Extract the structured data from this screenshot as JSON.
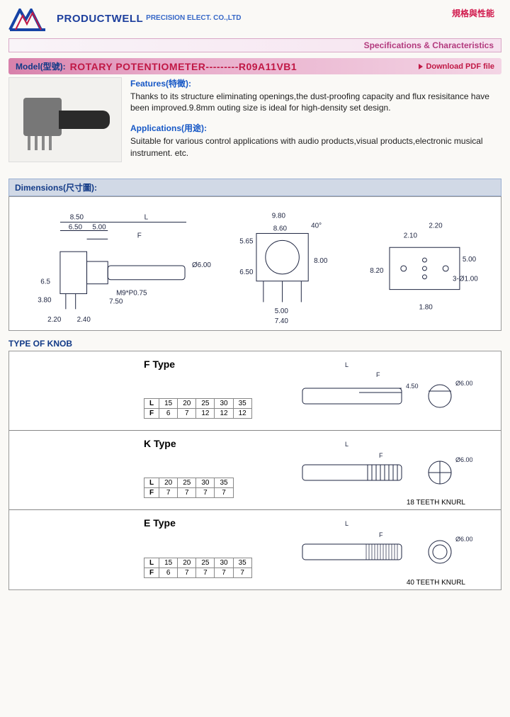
{
  "company": {
    "name": "PRODUCTWELL",
    "sub": "PRECISION ELECT. CO.,LTD",
    "zh_spec": "規格與性能",
    "spec_char": "Specifications & Characteristics"
  },
  "model_bar": {
    "label": "Model(型號):",
    "name": "ROTARY POTENTIOMETER---------R09A11VB1",
    "download": "Download PDF file"
  },
  "features": {
    "head": "Features(特徵):",
    "body": "Thanks to its structure eliminating openings,the dust-proofing capacity and flux resisitance have been improved.9.8mm outing size is ideal for high-density set design."
  },
  "applications": {
    "head": "Applications(用途):",
    "body": "Suitable for various control applications with audio products,visual products,electronic musical instrument. etc."
  },
  "dimensions": {
    "head": "Dimensions(尺寸圖):",
    "vals": {
      "a": "8.50",
      "b": "6.50",
      "c": "5.00",
      "d": "L",
      "e": "F",
      "f": "6.5",
      "g": "3.80",
      "h": "2.20",
      "i": "2.40",
      "j": "7.50",
      "k": "M9*P0.75",
      "dia": "Ø6.00",
      "top_w": "9.80",
      "top_ang": "40°",
      "top_in": "8.60",
      "top_h": "8.00",
      "top_side": "6.50",
      "top_vh": "5.65",
      "pin_sp": "5.00",
      "pin_tot": "7.40",
      "r_a": "2.20",
      "r_b": "2.10",
      "r_c": "8.20",
      "r_d": "5.00",
      "r_hole": "3-Ø1.00",
      "r_bot": "1.80"
    }
  },
  "type_of_knob": {
    "head": "TYPE OF KNOB",
    "rows": [
      {
        "title": "F Type",
        "table": {
          "headers": [
            "L",
            "F"
          ],
          "L": [
            "15",
            "20",
            "25",
            "30",
            "35"
          ],
          "F": [
            "6",
            "7",
            "12",
            "12",
            "12"
          ]
        },
        "diag": {
          "dim_l": "L",
          "dim_f": "F",
          "dia": "Ø6.00",
          "h": "4.50"
        },
        "note": ""
      },
      {
        "title": "K Type",
        "table": {
          "headers": [
            "L",
            "F"
          ],
          "L": [
            "20",
            "25",
            "30",
            "35"
          ],
          "F": [
            "7",
            "7",
            "7",
            "7"
          ]
        },
        "diag": {
          "dim_l": "L",
          "dim_f": "F",
          "dia": "Ø6.00"
        },
        "note": "18 TEETH KNURL"
      },
      {
        "title": "E Type",
        "table": {
          "headers": [
            "L",
            "F"
          ],
          "L": [
            "15",
            "20",
            "25",
            "30",
            "35"
          ],
          "F": [
            "6",
            "7",
            "7",
            "7",
            "7"
          ]
        },
        "diag": {
          "dim_l": "L",
          "dim_f": "F",
          "dia": "Ø6.00"
        },
        "note": "40 TEETH KNURL"
      }
    ]
  }
}
